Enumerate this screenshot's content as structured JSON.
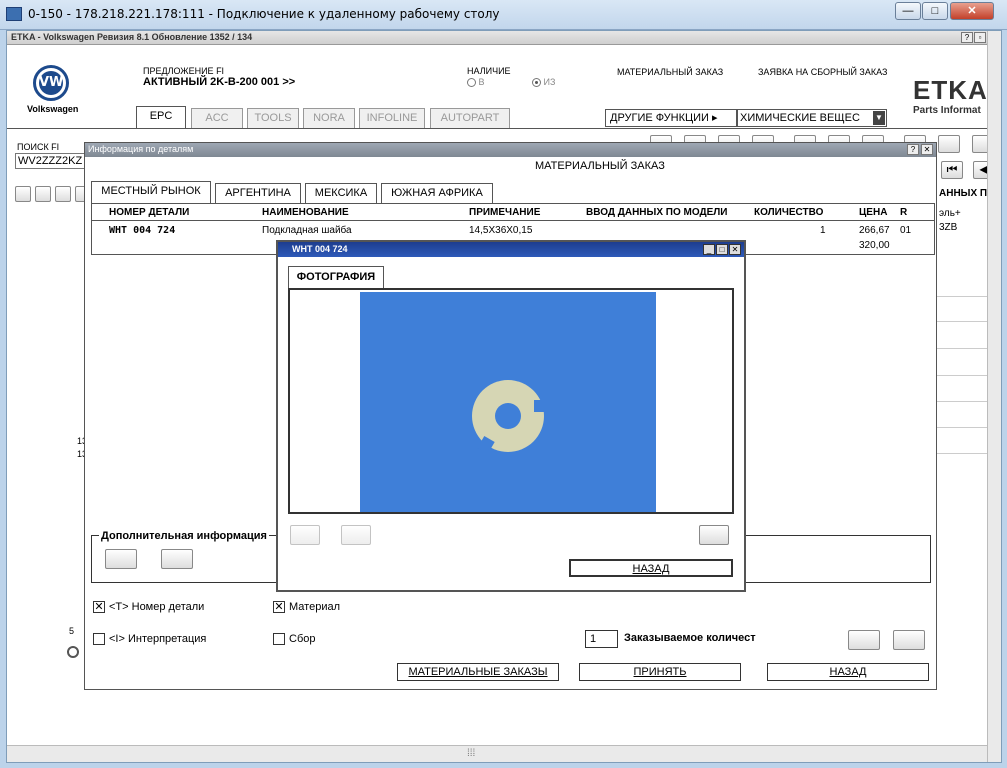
{
  "rdp": {
    "title": "0-150 - 178.218.221.178:111 - Подключение к удаленному рабочему столу",
    "minimize": "—",
    "maximize": "□",
    "close": "✕"
  },
  "etka": {
    "title": "ETKA - Volkswagen Ревизия 8.1 Обновление 1352 / 134",
    "brand": "Volkswagen",
    "logo_letters": "VW",
    "app_logo": "ETKA",
    "app_logo_sub": "Parts Informat",
    "proposal_label": "ПРЕДЛОЖЕНИЕ FI",
    "proposal_value": "АКТИВНЫЙ  2K-B-200 001 >>",
    "availability_label": "НАЛИЧИЕ",
    "radio_in": "В",
    "radio_out": "ИЗ",
    "material_order_label": "МАТЕРИАЛЬНЫЙ ЗАКАЗ",
    "assembly_order_label": "ЗАЯВКА НА СБОРНЫЙ ЗАКАЗ",
    "tabs": [
      "EPC",
      "ACC",
      "TOOLS",
      "NORA",
      "INFOLINE",
      "AUTOPART"
    ],
    "other_functions": "ДРУГИЕ ФУНКЦИИ",
    "chemicals": "ХИМИЧЕСКИЕ ВЕЩЕС",
    "search_label": "ПОИСК FI",
    "search_value": "WV2ZZZ2KZ",
    "right_header": "АННЫХ П",
    "right_cell1": "эль+",
    "right_cell2": "3ZB",
    "left_nums": [
      "13",
      "13",
      "5"
    ]
  },
  "dialog": {
    "title": "Информация по деталям",
    "heading": "МАТЕРИАЛЬНЫЙ ЗАКАЗ",
    "tabs": [
      "МЕСТНЫЙ РЫНОК",
      "АРГЕНТИНА",
      "МЕКСИКА",
      "ЮЖНАЯ АФРИКА"
    ],
    "columns": [
      "НОМЕР ДЕТАЛИ",
      "НАИМЕНОВАНИЕ",
      "ПРИМЕЧАНИЕ",
      "ВВОД ДАННЫХ ПО МОДЕЛИ",
      "КОЛИЧЕСТВО",
      "ЦЕНА",
      "R"
    ],
    "row": {
      "part": "WHT 004 724",
      "name": "Подкладная шайба",
      "note": "14,5X36X0,15",
      "model": "",
      "qty": "1",
      "price": "266,67",
      "price2": "320,00",
      "r": "01"
    },
    "extra_info": "Дополнительная информация",
    "chk_part": "<T> Номер детали",
    "chk_material": "Материал",
    "chk_interp": "<I> Интерпретация",
    "chk_assembly": "Сбор",
    "order_qty": "1",
    "order_qty_label": "Заказываемое количест",
    "btn_orders": "МАТЕРИАЛЬНЫЕ ЗАКАЗЫ",
    "btn_accept": "ПРИНЯТЬ",
    "btn_back": "НАЗАД",
    "help": "?",
    "close": "✕"
  },
  "popup": {
    "title": "WHT 004 724",
    "tab": "ФОТОГРАФИЯ",
    "back": "НАЗАД",
    "photo_bg": "#3f7fd8"
  },
  "scrollbar": {
    "grip": "⁞⁞⁞"
  }
}
